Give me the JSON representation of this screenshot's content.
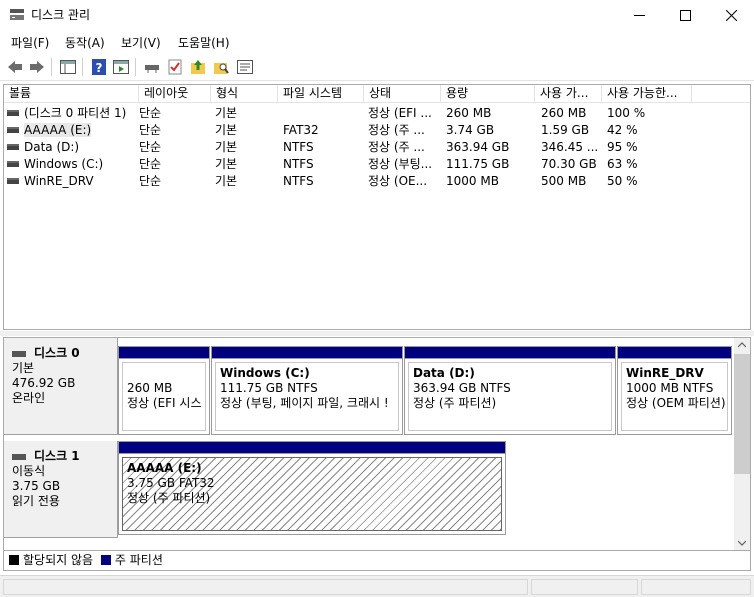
{
  "window": {
    "title": "디스크 관리"
  },
  "menu": [
    "파일(F)",
    "동작(A)",
    "보기(V)",
    "도움말(H)"
  ],
  "toolbar": {
    "icons": [
      "back-arrow-icon",
      "forward-arrow-icon",
      "console-tree-icon",
      "help-icon",
      "action-pane-icon",
      "connect-drive-icon",
      "check-icon",
      "folder-up-icon",
      "search-folder-icon",
      "properties-icon"
    ]
  },
  "volume_list": {
    "columns": [
      "볼륨",
      "레이아웃",
      "형식",
      "파일 시스템",
      "상태",
      "용량",
      "사용 가...",
      "사용 가능한..."
    ],
    "rows": [
      [
        "(디스크 0 파티션 1)",
        "단순",
        "기본",
        "",
        "정상 (EFI ...",
        "260 MB",
        "260 MB",
        "100 %"
      ],
      [
        "AAAAA (E:)",
        "단순",
        "기본",
        "FAT32",
        "정상 (주 ...",
        "3.74 GB",
        "1.59 GB",
        "42 %"
      ],
      [
        "Data (D:)",
        "단순",
        "기본",
        "NTFS",
        "정상 (주 ...",
        "363.94 GB",
        "346.45 ...",
        "95 %"
      ],
      [
        "Windows (C:)",
        "단순",
        "기본",
        "NTFS",
        "정상 (부팅...",
        "111.75 GB",
        "70.30 GB",
        "63 %"
      ],
      [
        "WinRE_DRV",
        "단순",
        "기본",
        "NTFS",
        "정상 (OE...",
        "1000 MB",
        "500 MB",
        "50 %"
      ]
    ]
  },
  "disks": [
    {
      "name": "디스크 0",
      "type": "기본",
      "size": "476.92 GB",
      "status": "온라인",
      "partitions": [
        {
          "name": "",
          "size": "260 MB",
          "status": "정상 (EFI 시스"
        },
        {
          "name": "Windows  (C:)",
          "size": "111.75 GB NTFS",
          "status": "정상 (부팅, 페이지 파일, 크래시 !"
        },
        {
          "name": "Data  (D:)",
          "size": "363.94 GB NTFS",
          "status": "정상 (주 파티션)"
        },
        {
          "name": "WinRE_DRV",
          "size": "1000 MB NTFS",
          "status": "정상 (OEM 파티션)"
        }
      ]
    },
    {
      "name": "디스크 1",
      "type": "이동식",
      "size": "3.75 GB",
      "status": "읽기 전용",
      "partitions": [
        {
          "name": "AAAAA  (E:)",
          "size": "3.75 GB FAT32",
          "status": "정상 (주 파티션)"
        }
      ]
    }
  ],
  "legend": {
    "unallocated": "할당되지 않음",
    "primary": "주 파티션"
  },
  "colors": {
    "primary_partition": "#000080",
    "unallocated": "#000000"
  }
}
